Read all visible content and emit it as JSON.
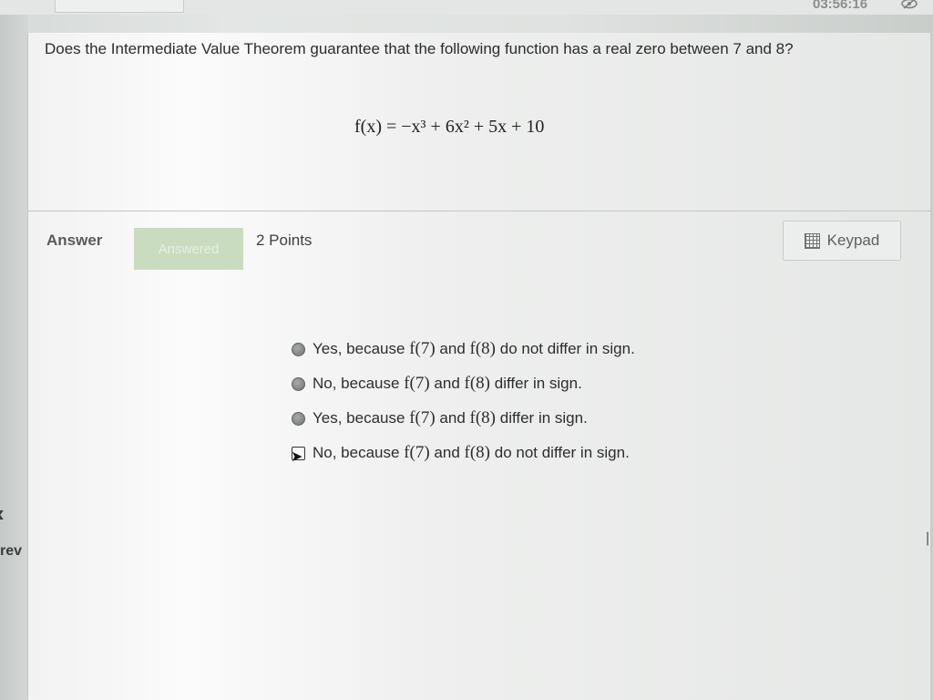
{
  "header": {
    "timer": "03:56:16",
    "visibility_icon": "eye-slash-icon"
  },
  "question": {
    "text": "Does the Intermediate Value Theorem guarantee that the following function has a real zero between 7 and 8?",
    "formula": {
      "lhs": "f(x) =",
      "rhs": "−x³ + 6x² + 5x + 10"
    }
  },
  "answer_bar": {
    "answer_label": "Answer",
    "status_badge": "Answered",
    "points": "2 Points",
    "keypad_label": "Keypad",
    "keypad_icon": "calculator-icon"
  },
  "options": [
    {
      "prefix": "Yes, because",
      "f1": "f(7)",
      "mid": "and",
      "f2": "f(8)",
      "suffix": "do not differ in sign.",
      "selected": false
    },
    {
      "prefix": "No, because",
      "f1": "f(7)",
      "mid": "and",
      "f2": "f(8)",
      "suffix": "differ in sign.",
      "selected": false
    },
    {
      "prefix": "Yes, because",
      "f1": "f(7)",
      "mid": "and",
      "f2": "f(8)",
      "suffix": "differ in sign.",
      "selected": false
    },
    {
      "prefix": "No, because",
      "f1": "f(7)",
      "mid": "and",
      "f2": "f(8)",
      "suffix": "do not differ in sign.",
      "selected": true
    }
  ],
  "nav": {
    "prev_label": "rev",
    "prev_icon": "chevron-left-icon"
  },
  "colors": {
    "answered_badge_bg": "#c9dcc0",
    "page_bg": "#eeefee"
  }
}
